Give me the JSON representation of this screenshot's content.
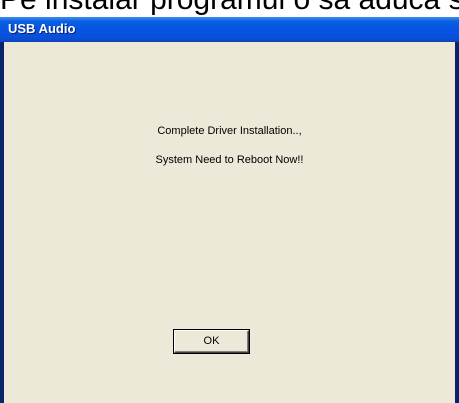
{
  "header_caption": "Pe instalar programul o sa aduca si",
  "window": {
    "title": "USB Audio"
  },
  "message": {
    "line1": "Complete Driver Installation..,",
    "line2": "System Need to Reboot Now!!"
  },
  "buttons": {
    "ok_label": "OK"
  },
  "colors": {
    "titlebar_blue": "#0554e3",
    "frame_blue": "#0a246a",
    "dialog_background": "#ece9d8"
  }
}
